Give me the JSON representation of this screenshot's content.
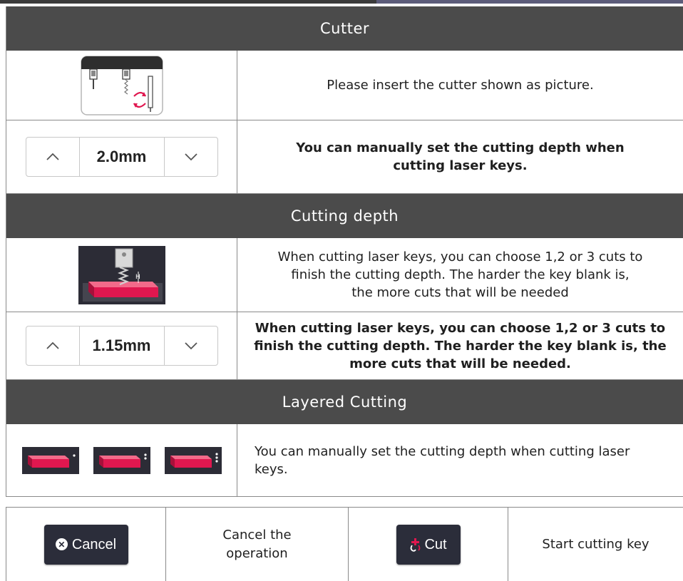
{
  "sections": {
    "cutter": {
      "title": "Cutter",
      "insert_desc": "Please insert the cutter shown as picture.",
      "stepper_value": "2.0mm",
      "stepper_desc_line1": "You can manually set the cutting depth when",
      "stepper_desc_line2": "cutting laser keys."
    },
    "cutting_depth": {
      "title": "Cutting depth",
      "image_desc_line1": "When cutting laser keys, you can choose 1,2 or 3 cuts to",
      "image_desc_line2": "finish the cutting depth. The harder the key blank is,",
      "image_desc_line3": "the more cuts that will be needed",
      "stepper_value": "1.15mm",
      "stepper_desc_line1": "When cutting laser keys, you can choose 1,2 or 3 cuts to",
      "stepper_desc_line2": "finish the cutting depth. The harder the key blank is, the",
      "stepper_desc_line3": "more cuts that will be needed."
    },
    "layered_cutting": {
      "title": "Layered Cutting",
      "desc_line1": "You can manually set the cutting depth when cutting laser",
      "desc_line2": "keys."
    }
  },
  "footer": {
    "cancel_button": "Cancel",
    "cancel_desc_line1": "Cancel the",
    "cancel_desc_line2": "operation",
    "cut_button": "Cut",
    "cut_desc": "Start cutting key"
  },
  "icons": {
    "cutter_image": "cutter-insert-icon",
    "depth_image": "cutting-depth-icon",
    "layer_images": [
      "layer-1-cut-icon",
      "layer-2-cuts-icon",
      "layer-3-cuts-icon"
    ],
    "stepper_up": "chevron-up-icon",
    "stepper_down": "chevron-down-icon",
    "cancel": "close-circle-icon",
    "cut": "cut-icon"
  },
  "colors": {
    "header_bg": "#4b4b4b",
    "button_bg": "#2b2d3a",
    "key_blank": "#e0174f"
  }
}
